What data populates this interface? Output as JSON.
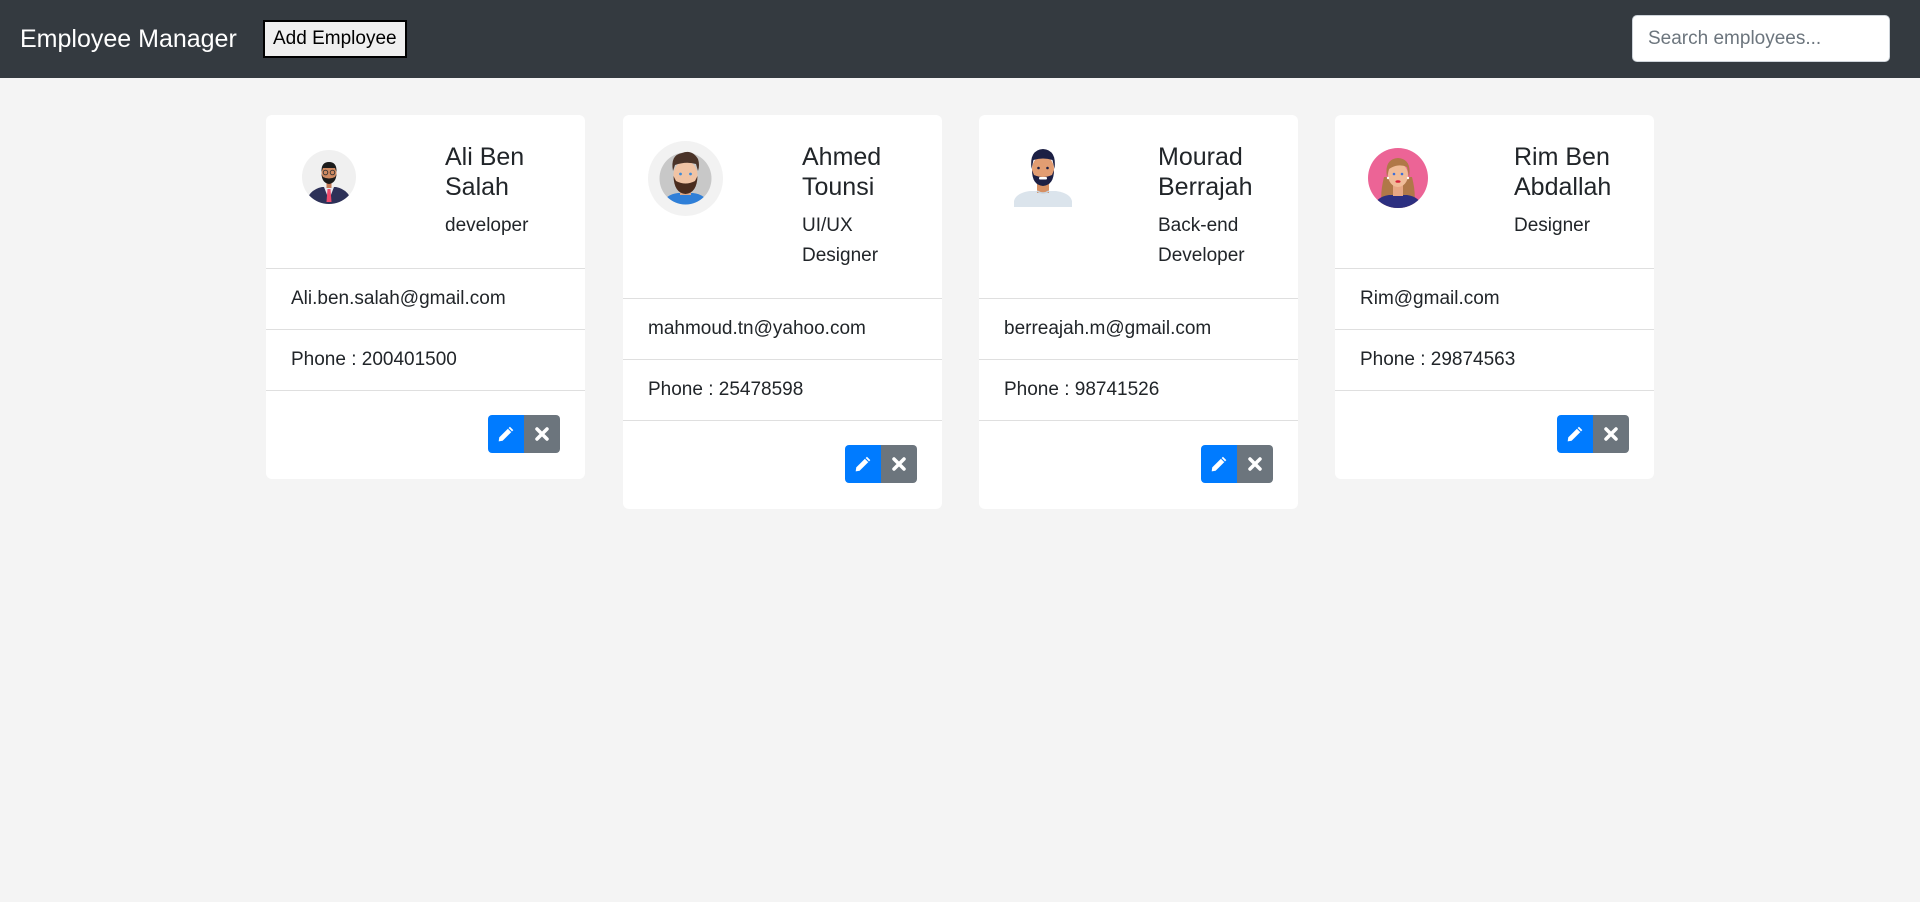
{
  "header": {
    "brand": "Employee Manager",
    "add_button_label": "Add Employee",
    "search_placeholder": "Search employees...",
    "search_value": ""
  },
  "colors": {
    "navbar": "#343a40",
    "edit_button": "#007bff",
    "delete_button": "#6c757d",
    "background": "#f4f4f4"
  },
  "employees": [
    {
      "name": "Ali Ben Salah",
      "role": "developer",
      "email": "Ali.ben.salah@gmail.com",
      "phone": "Phone : 200401500",
      "avatar": "man-suit-glasses-avatar"
    },
    {
      "name": "Ahmed Tounsi",
      "role": "UI/UX Designer",
      "email": "mahmoud.tn@yahoo.com",
      "phone": "Phone : 25478598",
      "avatar": "bearded-man-avatar"
    },
    {
      "name": "Mourad Berrajah",
      "role": "Back-end Developer",
      "email": "berreajah.m@gmail.com",
      "phone": "Phone : 98741526",
      "avatar": "man-beard-tshirt-avatar"
    },
    {
      "name": "Rim Ben Abdallah",
      "role": "Designer",
      "email": "Rim@gmail.com",
      "phone": "Phone : 29874563",
      "avatar": "woman-avatar"
    }
  ],
  "icons": {
    "edit": "pencil-icon",
    "delete": "close-icon"
  }
}
